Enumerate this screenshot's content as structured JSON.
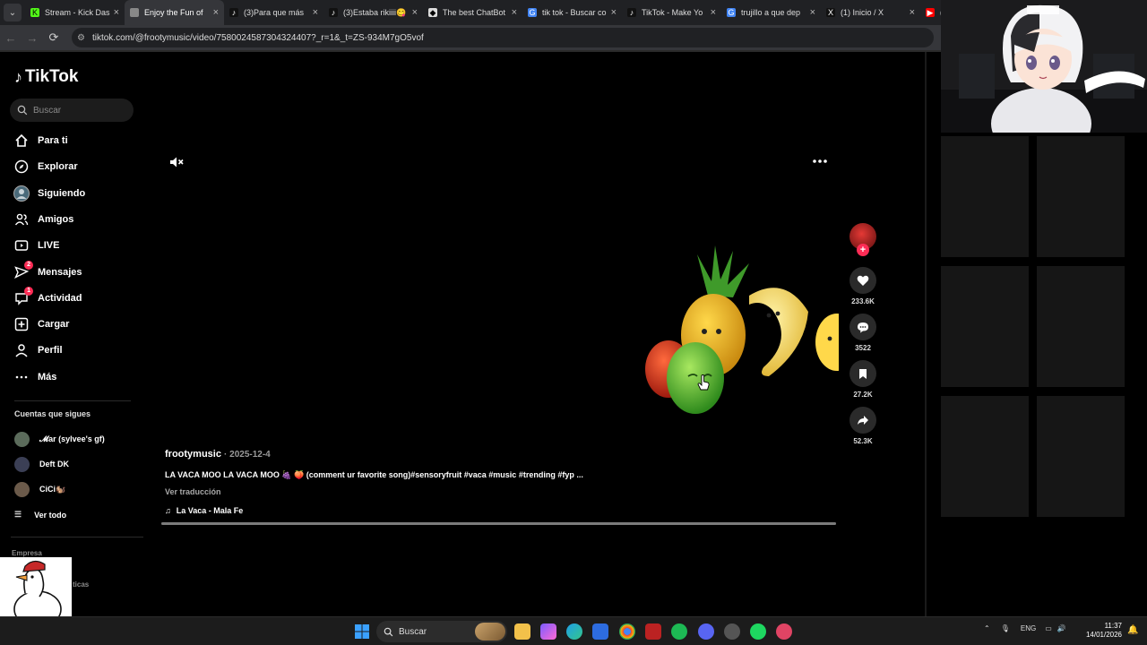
{
  "browser": {
    "tabs": [
      {
        "title": "Stream - Kick Dash",
        "favicon": "kick-icon",
        "active": false
      },
      {
        "title": "Enjoy the Fun of",
        "favicon": "blank-icon",
        "active": true
      },
      {
        "title": "(3)Para que más",
        "favicon": "tiktok-icon",
        "active": false
      },
      {
        "title": "(3)Estaba rikiiii😋",
        "favicon": "tiktok-icon",
        "active": false
      },
      {
        "title": "The best ChatBot",
        "favicon": "chatbot-icon",
        "active": false
      },
      {
        "title": "tik tok - Buscar co",
        "favicon": "google-icon",
        "active": false
      },
      {
        "title": "TikTok - Make Yo",
        "favicon": "tiktok-icon",
        "active": false
      },
      {
        "title": "trujillo a que dep",
        "favicon": "google-icon",
        "active": false
      },
      {
        "title": "(1) Inicio / X",
        "favicon": "x-icon",
        "active": false
      },
      {
        "title": "(2",
        "favicon": "youtube-icon",
        "active": false
      }
    ],
    "url": "tiktok.com/@frootymusic/video/7580024587304324407?_r=1&_t=ZS-934M7gO5vof"
  },
  "sidebar": {
    "logo": "TikTok",
    "search_placeholder": "Buscar",
    "items": [
      {
        "label": "Para ti",
        "icon": "home-icon"
      },
      {
        "label": "Explorar",
        "icon": "compass-icon"
      },
      {
        "label": "Siguiendo",
        "icon": "following-avatar-icon"
      },
      {
        "label": "Amigos",
        "icon": "friends-icon"
      },
      {
        "label": "LIVE",
        "icon": "live-icon"
      },
      {
        "label": "Mensajes",
        "icon": "send-icon",
        "badge": "2"
      },
      {
        "label": "Actividad",
        "icon": "inbox-icon",
        "badge": "1"
      },
      {
        "label": "Cargar",
        "icon": "upload-icon"
      },
      {
        "label": "Perfil",
        "icon": "profile-icon"
      },
      {
        "label": "Más",
        "icon": "more-icon"
      }
    ],
    "following_title": "Cuentas que sigues",
    "accounts": [
      {
        "name": "𝓜ar (sylvee's gf)",
        "avatar_color": "#5b6b5b"
      },
      {
        "name": "Deft DK",
        "avatar_color": "#3b3f55"
      },
      {
        "name": "CiCi🐿️",
        "avatar_color": "#6b5a4a"
      }
    ],
    "see_all": "Ver todo",
    "company": "Empresa",
    "policies": "ticas"
  },
  "video": {
    "author": "frootymusic",
    "date": "2025-12-4",
    "caption": "LA VACA MOO LA VACA MOO 🍇 🍑 (comment ur favorite song)#sensoryfruit #vaca #music #trending #fyp ...",
    "translate": "Ver traducción",
    "sound": "La Vaca - Mala Fe",
    "progress_fraction": 1.0
  },
  "actions": {
    "likes": "233.6K",
    "comments": "3522",
    "saves": "27.2K",
    "shares": "52.3K"
  },
  "taskbar": {
    "search_placeholder": "Buscar",
    "language": "ENG",
    "time": "11:37",
    "date": "14/01/2026"
  },
  "colors": {
    "accent": "#fe2c55",
    "background": "#000000",
    "chrome_tabbar": "#202124",
    "chrome_toolbar": "#35363a"
  }
}
